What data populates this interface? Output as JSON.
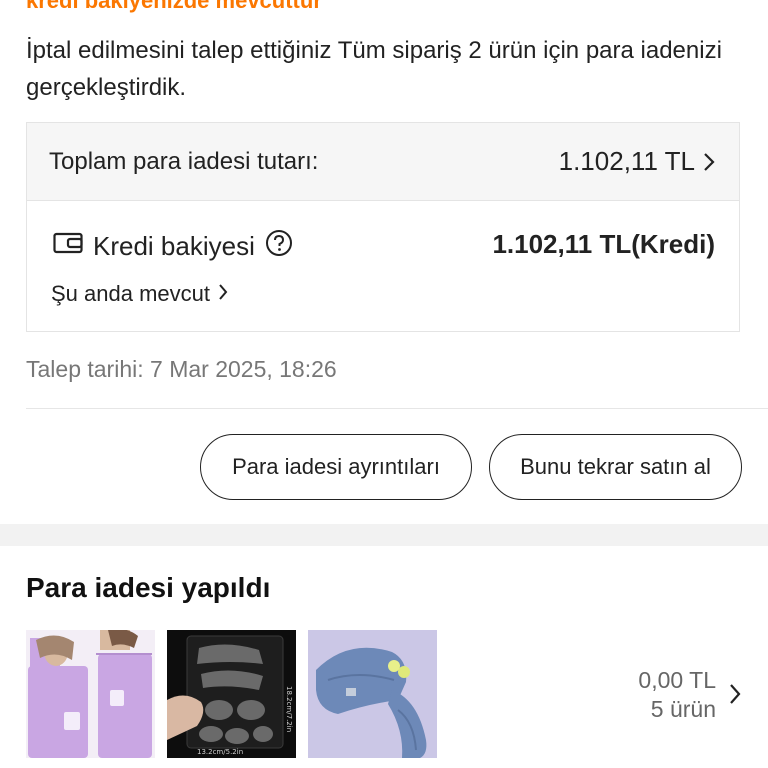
{
  "header": {
    "partial_heading": "kredi bakiyenizde mevcuttur"
  },
  "message": "İptal edilmesini talep ettiğiniz Tüm sipariş 2 ürün için para iadenizi gerçekleştirdik.",
  "refund_summary": {
    "total_label": "Toplam para iadesi tutarı:",
    "total_amount": "1.102,11 TL",
    "credit_label": "Kredi bakiyesi",
    "credit_amount": "1.102,11 TL(Kredi)",
    "current_status": "Şu anda mevcut"
  },
  "request_date": "Talep tarihi: 7 Mar 2025, 18:26",
  "buttons": {
    "details": "Para iadesi ayrıntıları",
    "rebuy": "Bunu tekrar satın al"
  },
  "refunded_section": {
    "title": "Para iadesi yapıldı",
    "amount": "0,00 TL",
    "item_count": "5 ürün",
    "thumbnail_labels": [
      "18.2cm/7.2in",
      "13.2cm/5.2in"
    ]
  },
  "colors": {
    "accent": "#fb7701",
    "towel_purple": "#c9a6e3"
  }
}
